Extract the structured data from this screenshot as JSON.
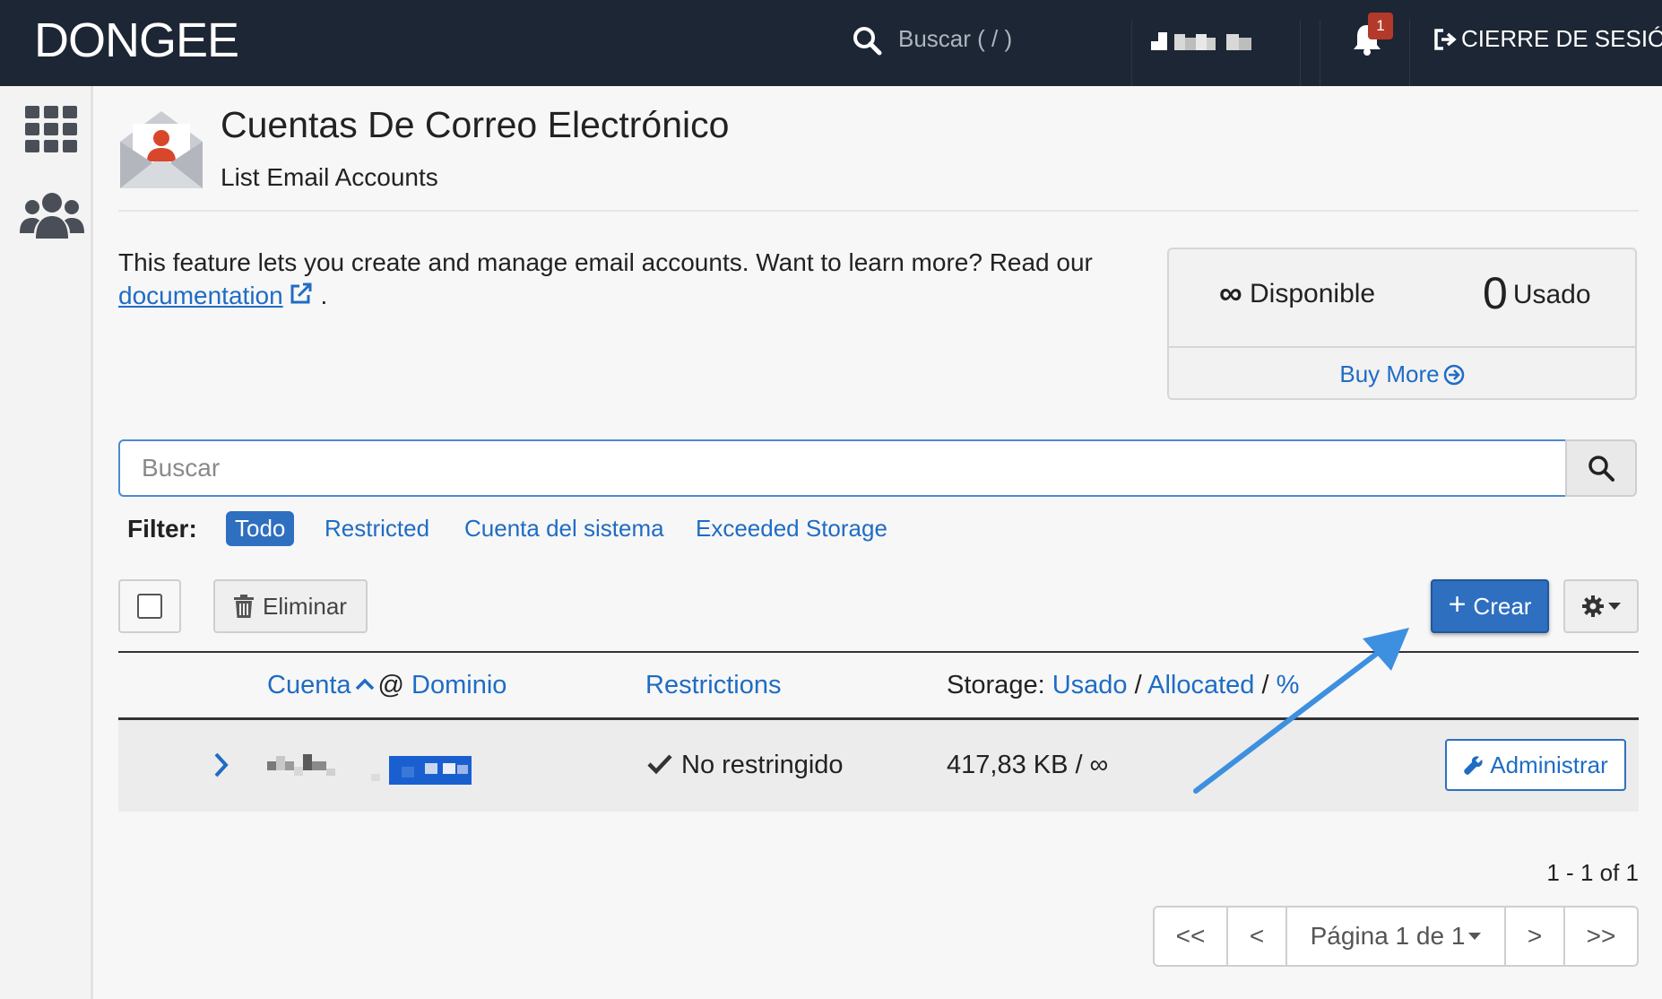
{
  "header": {
    "logo": "DONGEE",
    "search_placeholder": "Buscar ( / )",
    "notification_count": "1",
    "logout_label": "CIERRE DE SESIÓN"
  },
  "page": {
    "title": "Cuentas De Correo Electrónico",
    "subtitle": "List Email Accounts",
    "intro_text": "This feature lets you create and manage email accounts. Want to learn more? Read our",
    "doc_link": "documentation",
    "intro_end": "."
  },
  "stats": {
    "available_symbol": "∞",
    "available_label": "Disponible",
    "used_value": "0",
    "used_label": "Usado",
    "buy_more": "Buy More"
  },
  "search": {
    "placeholder": "Buscar"
  },
  "filter": {
    "label": "Filter:",
    "items": [
      "Todo",
      "Restricted",
      "Cuenta del sistema",
      "Exceeded Storage"
    ],
    "active": "Todo"
  },
  "toolbar": {
    "delete_label": "Eliminar",
    "create_label": "Crear"
  },
  "table": {
    "headers": {
      "account": "Cuenta",
      "at": "@",
      "domain": "Dominio",
      "restrictions": "Restrictions",
      "storage_prefix": "Storage:",
      "used": "Usado",
      "slash1": "/",
      "allocated": "Allocated",
      "slash2": "/",
      "percent": "%"
    },
    "rows": [
      {
        "restriction": "No restringido",
        "storage": "417,83 KB / ∞",
        "action": "Administrar"
      }
    ]
  },
  "pagination": {
    "range": "1 - 1 of 1",
    "first": "<<",
    "prev": "<",
    "page_label": "Página 1 de 1",
    "next": ">",
    "last": ">>"
  },
  "colors": {
    "topbar": "#1d2634",
    "accent": "#2e6fc0",
    "link": "#1f6cc4",
    "arrow": "#3d8fe0"
  }
}
